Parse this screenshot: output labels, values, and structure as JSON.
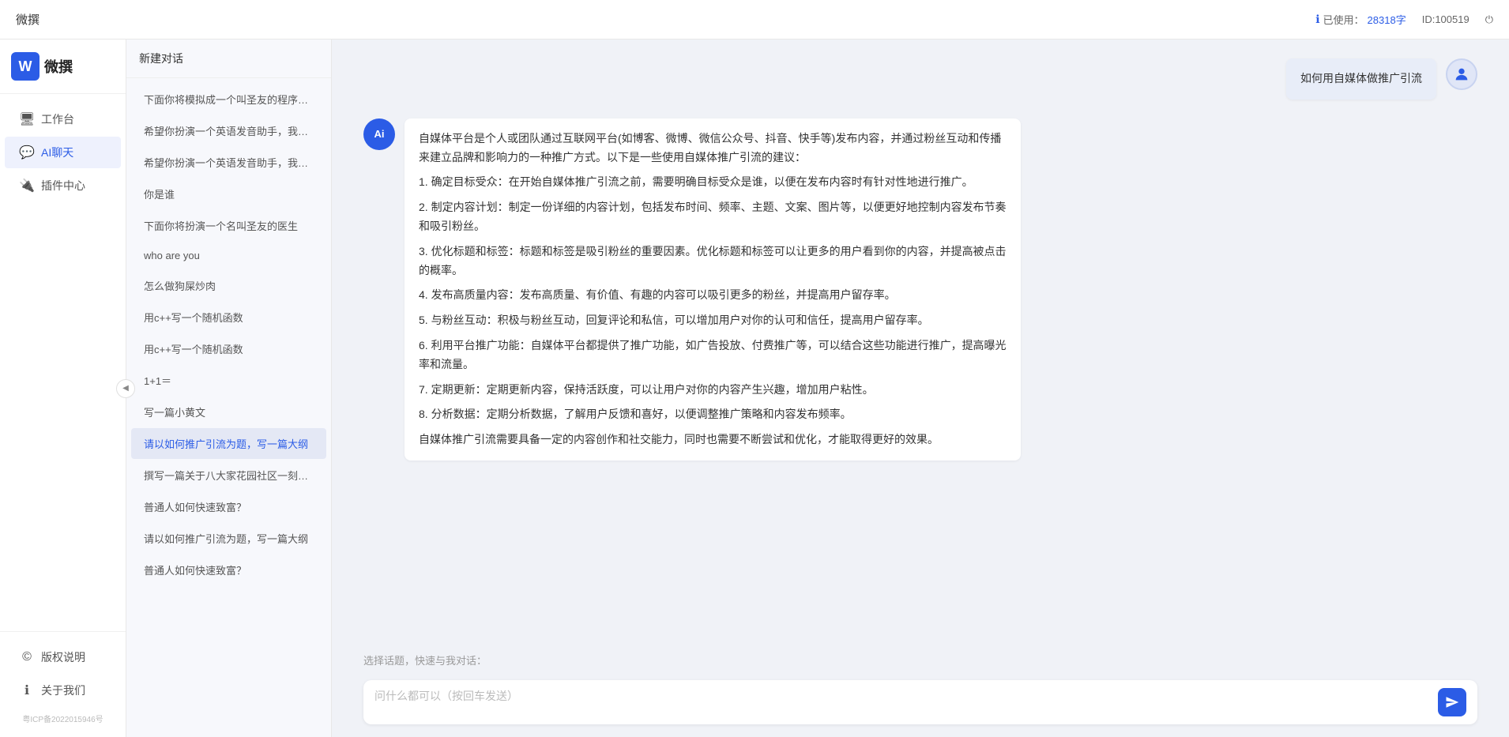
{
  "topbar": {
    "title": "微撰",
    "usage_label": "已使用：",
    "usage_value": "28318字",
    "id_label": "ID:100519",
    "logout_icon": "⏻"
  },
  "sidebar": {
    "logo_letter": "W",
    "logo_text": "微撰",
    "nav_items": [
      {
        "id": "workbench",
        "icon": "🖥",
        "label": "工作台"
      },
      {
        "id": "ai-chat",
        "icon": "💬",
        "label": "AI聊天",
        "active": true
      },
      {
        "id": "plugin",
        "icon": "🔌",
        "label": "插件中心"
      }
    ],
    "bottom_items": [
      {
        "id": "copyright",
        "icon": "©",
        "label": "版权说明"
      },
      {
        "id": "about",
        "icon": "ℹ",
        "label": "关于我们"
      }
    ],
    "copyright": "粤ICP备2022015946号",
    "collapse_icon": "◀"
  },
  "history": {
    "new_chat": "新建对话",
    "items": [
      {
        "id": 1,
        "text": "下面你将模拟成一个叫圣友的程序员，我说..."
      },
      {
        "id": 2,
        "text": "希望你扮演一个英语发音助手，我提供给你..."
      },
      {
        "id": 3,
        "text": "希望你扮演一个英语发音助手，我提供给你..."
      },
      {
        "id": 4,
        "text": "你是谁"
      },
      {
        "id": 5,
        "text": "下面你将扮演一个名叫圣友的医生"
      },
      {
        "id": 6,
        "text": "who are you"
      },
      {
        "id": 7,
        "text": "怎么做狗屎炒肉"
      },
      {
        "id": 8,
        "text": "用c++写一个随机函数"
      },
      {
        "id": 9,
        "text": "用c++写一个随机函数"
      },
      {
        "id": 10,
        "text": "1+1＝"
      },
      {
        "id": 11,
        "text": "写一篇小黄文"
      },
      {
        "id": 12,
        "text": "请以如何推广引流为题，写一篇大纲"
      },
      {
        "id": 13,
        "text": "撰写一篇关于八大家花园社区一刻钟便民生..."
      },
      {
        "id": 14,
        "text": "普通人如何快速致富？"
      },
      {
        "id": 15,
        "text": "请以如何推广引流为题，写一篇大纲"
      },
      {
        "id": 16,
        "text": "普通人如何快速致富？"
      }
    ]
  },
  "chat": {
    "user_message": "如何用自媒体做推广引流",
    "ai_response_paragraphs": [
      "自媒体平台是个人或团队通过互联网平台(如博客、微博、微信公众号、抖音、快手等)发布内容，并通过粉丝互动和传播来建立品牌和影响力的一种推广方式。以下是一些使用自媒体推广引流的建议：",
      "1. 确定目标受众：在开始自媒体推广引流之前，需要明确目标受众是谁，以便在发布内容时有针对性地进行推广。",
      "2. 制定内容计划：制定一份详细的内容计划，包括发布时间、频率、主题、文案、图片等，以便更好地控制内容发布节奏和吸引粉丝。",
      "3. 优化标题和标签：标题和标签是吸引粉丝的重要因素。优化标题和标签可以让更多的用户看到你的内容，并提高被点击的概率。",
      "4. 发布高质量内容：发布高质量、有价值、有趣的内容可以吸引更多的粉丝，并提高用户留存率。",
      "5. 与粉丝互动：积极与粉丝互动，回复评论和私信，可以增加用户对你的认可和信任，提高用户留存率。",
      "6. 利用平台推广功能：自媒体平台都提供了推广功能，如广告投放、付费推广等，可以结合这些功能进行推广，提高曝光率和流量。",
      "7. 定期更新：定期更新内容，保持活跃度，可以让用户对你的内容产生兴趣，增加用户粘性。",
      "8. 分析数据：定期分析数据，了解用户反馈和喜好，以便调整推广策略和内容发布频率。",
      "自媒体推广引流需要具备一定的内容创作和社交能力，同时也需要不断尝试和优化，才能取得更好的效果。"
    ],
    "quick_topics_label": "选择话题，快速与我对话：",
    "input_placeholder": "问什么都可以（按回车发送）"
  }
}
